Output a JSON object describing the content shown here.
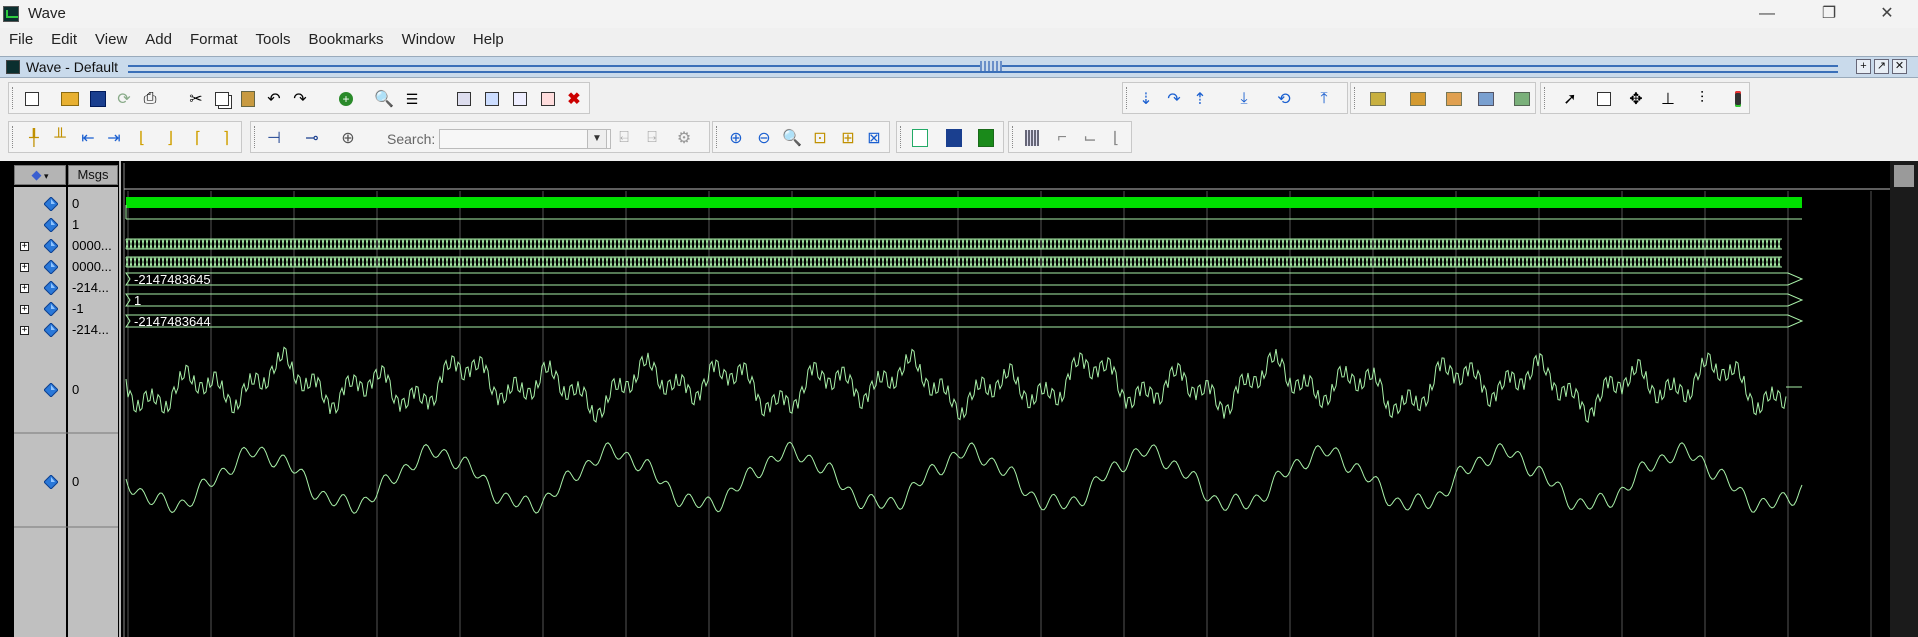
{
  "window": {
    "title": "Wave",
    "min_glyph": "—",
    "restore_glyph": "❐",
    "close_glyph": "✕"
  },
  "menu": [
    "File",
    "Edit",
    "View",
    "Add",
    "Format",
    "Tools",
    "Bookmarks",
    "Window",
    "Help"
  ],
  "subwindow": {
    "title": "Wave - Default"
  },
  "toolbar": {
    "search_label": "Search:",
    "search_value": ""
  },
  "columns": {
    "msgs_header": "Msgs"
  },
  "signals": [
    {
      "value": "0",
      "expandable": false
    },
    {
      "value": "1",
      "expandable": false
    },
    {
      "value": "0000...",
      "expandable": true
    },
    {
      "value": "0000...",
      "expandable": true
    },
    {
      "value": "-214...",
      "expandable": true
    },
    {
      "value": "-1",
      "expandable": true
    },
    {
      "value": "-214...",
      "expandable": true
    },
    {
      "value": "0",
      "expandable": false
    },
    {
      "value": "0",
      "expandable": false
    }
  ],
  "wave_labels": [
    "-2147483645",
    "1",
    "-2147483644"
  ],
  "colors": {
    "wave": "#a8f0a8",
    "bus_fill": "#00e000",
    "grid": "#555555",
    "background": "#000000"
  }
}
